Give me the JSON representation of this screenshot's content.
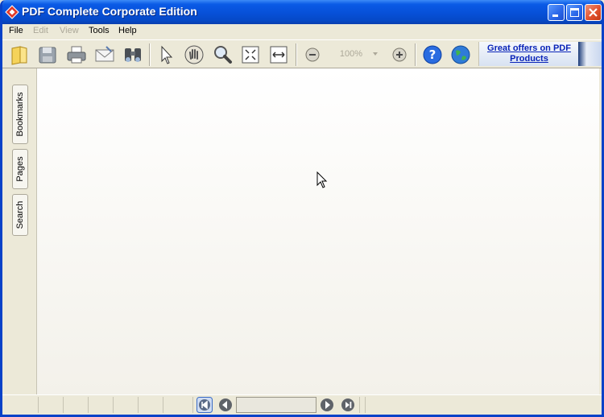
{
  "window": {
    "title": "PDF Complete Corporate Edition"
  },
  "menu": [
    {
      "label": "File",
      "enabled": true
    },
    {
      "label": "Edit",
      "enabled": false
    },
    {
      "label": "View",
      "enabled": false
    },
    {
      "label": "Tools",
      "enabled": true
    },
    {
      "label": "Help",
      "enabled": true
    }
  ],
  "toolbar": {
    "zoom_value": "100%",
    "promo_text": "Great offers on PDF Products"
  },
  "sidepanel": {
    "tabs": [
      "Bookmarks",
      "Pages",
      "Search"
    ]
  },
  "colors": {
    "titlebar": "#0750d8",
    "link": "#0a24b8",
    "chrome": "#ece9d8"
  }
}
